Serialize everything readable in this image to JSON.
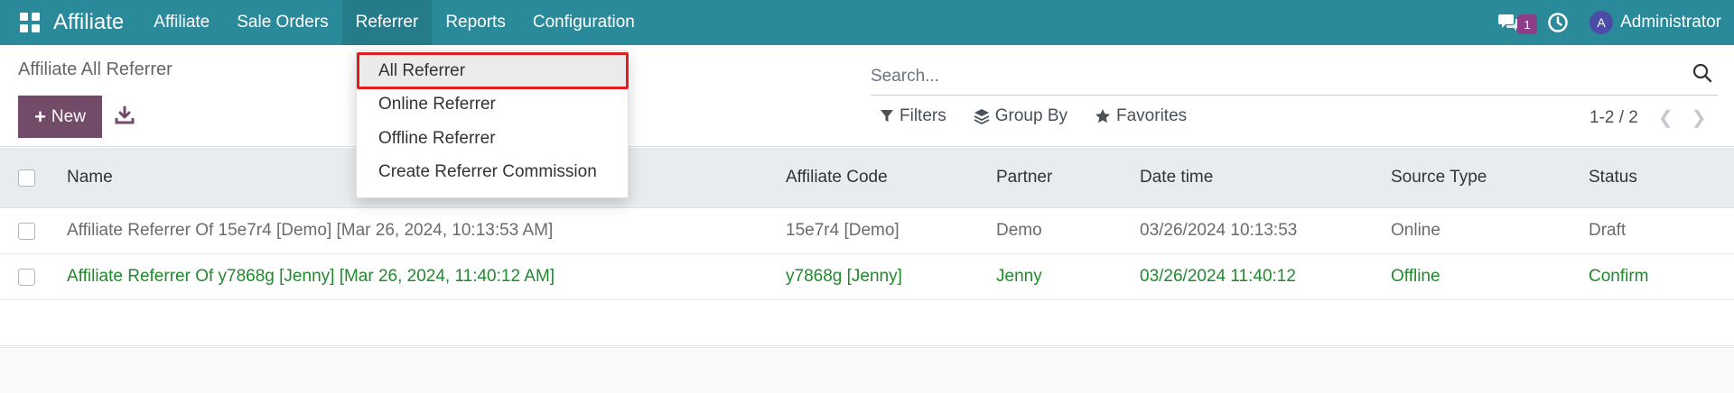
{
  "navbar": {
    "apps_icon": "apps-grid-icon",
    "brand": "Affiliate",
    "menu": [
      "Affiliate",
      "Sale Orders",
      "Referrer",
      "Reports",
      "Configuration"
    ],
    "active_menu": "Referrer",
    "chat_badge": "1",
    "avatar_letter": "A",
    "user": "Administrator",
    "color": "#2a8a99"
  },
  "control": {
    "breadcrumb": "Affiliate All Referrer",
    "new_label": "New",
    "search_placeholder": "Search...",
    "filters_label": "Filters",
    "groupby_label": "Group By",
    "favorites_label": "Favorites",
    "pager": "1-2 / 2"
  },
  "dropdown": {
    "items": [
      "All Referrer",
      "Online Referrer",
      "Offline Referrer",
      "Create Referrer Commission"
    ],
    "selected": "All Referrer"
  },
  "table": {
    "columns": [
      "Name",
      "Affiliate Code",
      "Partner",
      "Date time",
      "Source Type",
      "Status"
    ],
    "rows": [
      {
        "name": "Affiliate Referrer Of 15e7r4 [Demo] [Mar 26, 2024, 10:13:53 AM]",
        "code": "15e7r4 [Demo]",
        "partner": "Demo",
        "date": "03/26/2024 10:13:53",
        "source": "Online",
        "status": "Draft"
      },
      {
        "name": "Affiliate Referrer Of y7868g [Jenny] [Mar 26, 2024, 11:40:12 AM]",
        "code": "y7868g [Jenny]",
        "partner": "Jenny",
        "date": "03/26/2024 11:40:12",
        "source": "Offline",
        "status": "Confirm"
      }
    ]
  },
  "colors": {
    "primary": "#714b67",
    "confirm_text": "#1f8a2b",
    "highlight_border": "#e01e1e"
  }
}
